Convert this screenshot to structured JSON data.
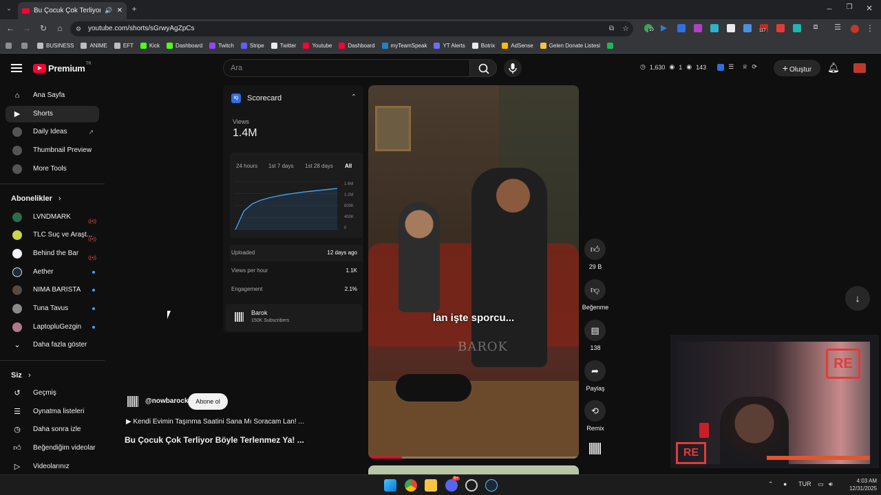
{
  "browser": {
    "tab_title": "Bu Çocuk Çok Terliyor Böyle",
    "url": "youtube.com/shorts/sGrwyAgZpCs",
    "bookmarks": [
      {
        "label": "BUSINESS",
        "color": "#bdbdbd"
      },
      {
        "label": "ANIME",
        "color": "#bdbdbd"
      },
      {
        "label": "EFT",
        "color": "#bdbdbd"
      },
      {
        "label": "Kick",
        "color": "#53fc18"
      },
      {
        "label": "Dashboard",
        "color": "#53fc18"
      },
      {
        "label": "Twitch",
        "color": "#9146ff"
      },
      {
        "label": "Stripe",
        "color": "#635bff"
      },
      {
        "label": "Twitter",
        "color": "#e8eaed"
      },
      {
        "label": "Youtube",
        "color": "#ff0033"
      },
      {
        "label": "Dashboard",
        "color": "#ff0033"
      },
      {
        "label": "myTeamSpeak",
        "color": "#2580c3"
      },
      {
        "label": "YT Alerts",
        "color": "#6d6dff"
      },
      {
        "label": "Botrix",
        "color": "#e8eaed"
      },
      {
        "label": "AdSense",
        "color": "#fbbc04"
      },
      {
        "label": "Gelen Donate Listesi",
        "color": "#f5c542"
      }
    ],
    "extension_badges": {
      "ext1": "10",
      "ext2": "117"
    }
  },
  "header": {
    "logo_text": "Premium",
    "country_code": "TR",
    "search_placeholder": "Ara",
    "stats": {
      "watching": "1,630",
      "online": "1",
      "views": "143"
    },
    "create_label": "Oluştur"
  },
  "sidebar": {
    "main_items": [
      {
        "label": "Ana Sayfa",
        "icon": "home-icon"
      },
      {
        "label": "Shorts",
        "icon": "shorts-icon",
        "active": true
      },
      {
        "label": "Daily Ideas",
        "icon": "vidiq-icon"
      },
      {
        "label": "Thumbnail Preview",
        "icon": "vidiq-icon"
      },
      {
        "label": "More Tools",
        "icon": "vidiq-icon"
      }
    ],
    "subscriptions_title": "Abonelikler",
    "subscriptions": [
      {
        "label": "LVNDMARK",
        "color": "#2d6b4f",
        "indicator": "live"
      },
      {
        "label": "TLC Suç ve Araşt...",
        "color": "#c9d64a",
        "indicator": "live"
      },
      {
        "label": "Behind the Bar",
        "color": "#f5f5f5",
        "indicator": "live"
      },
      {
        "label": "Aether",
        "color": "#1e2a3a",
        "indicator": "dot"
      },
      {
        "label": "NIMA BARISTA",
        "color": "#5a4a42",
        "indicator": "dot"
      },
      {
        "label": "Tuna Tavus",
        "color": "#8a8a8a",
        "indicator": "dot"
      },
      {
        "label": "LaptopluGezgin",
        "color": "#b07a8a",
        "indicator": "dot"
      }
    ],
    "show_more_label": "Daha fazla göster",
    "you_title": "Siz",
    "you_items": [
      {
        "label": "Geçmiş",
        "icon": "history-icon"
      },
      {
        "label": "Oynatma listeleri",
        "icon": "playlists-icon"
      },
      {
        "label": "Daha sonra izle",
        "icon": "watch-later-icon"
      },
      {
        "label": "Beğendiğim videolar",
        "icon": "liked-icon"
      },
      {
        "label": "Videolarınız",
        "icon": "your-videos-icon"
      }
    ]
  },
  "scorecard": {
    "badge": "IQ",
    "title": "Scorecard",
    "views_label": "Views",
    "views_value": "1.4M",
    "ranges": [
      {
        "label": "24 hours",
        "selected": false
      },
      {
        "label": "1st 7 days",
        "selected": false
      },
      {
        "label": "1st 28 days",
        "selected": false
      },
      {
        "label": "All",
        "selected": true
      }
    ],
    "metrics": [
      {
        "label": "Uploaded",
        "value": "12 days ago"
      },
      {
        "label": "Views per hour",
        "value": "1.1K"
      },
      {
        "label": "Engagement",
        "value": "2.1%"
      }
    ],
    "channel": {
      "name": "Barok",
      "subscribers": "150K Subscribers"
    }
  },
  "chart_data": {
    "type": "line",
    "x": [
      0,
      1,
      2,
      3,
      4,
      5,
      6,
      7,
      8,
      9,
      10,
      11,
      12
    ],
    "y": [
      0,
      620000,
      860000,
      980000,
      1060000,
      1120000,
      1170000,
      1210000,
      1250000,
      1280000,
      1310000,
      1340000,
      1370000
    ],
    "ylim": [
      0,
      1600000
    ],
    "yticks": [
      "1.6M",
      "1.2M",
      "800K",
      "400K",
      "0"
    ],
    "line_color": "#3ea6ff"
  },
  "video": {
    "caption": "lan işte sporcu...",
    "watermark": "BAROK",
    "progress": 0.16
  },
  "actions": {
    "like_count": "29 B",
    "dislike_label": "Beğenme",
    "comments_count": "138",
    "share_label": "Paylaş",
    "remix_label": "Remix"
  },
  "channel_info": {
    "handle": "@nowbarock",
    "subscribe_label": "Abone ol",
    "playlist_text": "▶ Kendi Evimin Taşınma Saatini Sana Mı Soracam Lan! ...",
    "title": "Bu Çocuk Çok Terliyor Böyle Terlenmez Ya! ..."
  },
  "webcam": {
    "logo_text": "RE"
  },
  "taskbar": {
    "language": "TUR",
    "time": "4:03 AM",
    "date": "12/31/2025",
    "discord_badge": "9+"
  }
}
